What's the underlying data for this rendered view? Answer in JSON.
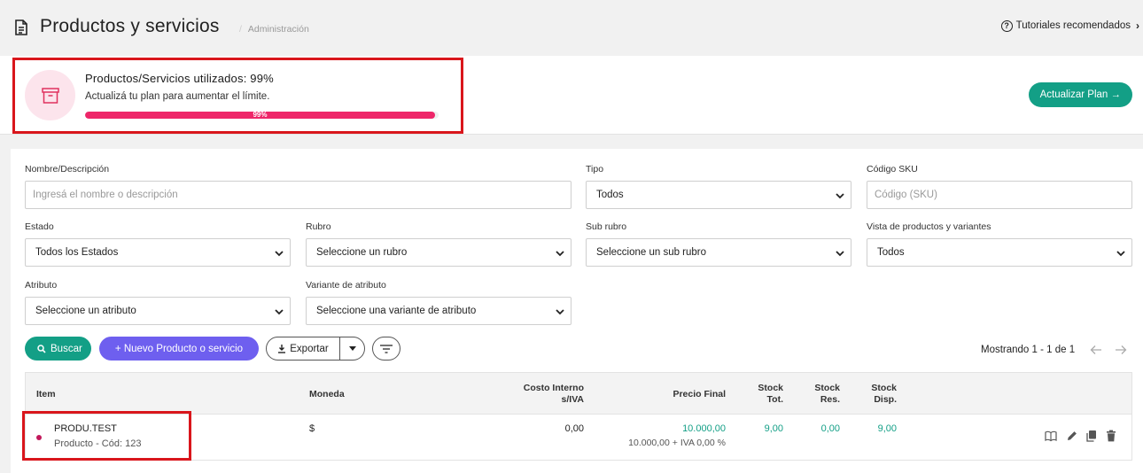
{
  "header": {
    "title": "Productos y servicios",
    "breadcrumb_sep": "/",
    "breadcrumb": "Administración",
    "tutorials_label": "Tutoriales recomendados"
  },
  "banner": {
    "usage_title": "Productos/Servicios utilizados: 99%",
    "usage_subtitle": "Actualizá tu plan para aumentar el límite.",
    "usage_percent": 99,
    "usage_bar_label": "99%",
    "upgrade_button": "Actualizar Plan →",
    "accent_color": "#ee2669"
  },
  "filters": {
    "name_label": "Nombre/Descripción",
    "name_placeholder": "Ingresá el nombre o descripción",
    "tipo_label": "Tipo",
    "tipo_value": "Todos",
    "sku_label": "Código SKU",
    "sku_placeholder": "Código (SKU)",
    "estado_label": "Estado",
    "estado_value": "Todos los Estados",
    "rubro_label": "Rubro",
    "rubro_value": "Seleccione un rubro",
    "subrubro_label": "Sub rubro",
    "subrubro_value": "Seleccione un sub rubro",
    "vista_label": "Vista de productos y variantes",
    "vista_value": "Todos",
    "atributo_label": "Atributo",
    "atributo_value": "Seleccione un atributo",
    "variante_label": "Variante de atributo",
    "variante_value": "Seleccione una variante de atributo"
  },
  "toolbar": {
    "search_button": "Buscar",
    "new_button": "+ Nuevo Producto o servicio",
    "export_button": "Exportar",
    "showing": "Mostrando 1 - 1 de 1"
  },
  "table": {
    "headers": {
      "item": "Item",
      "moneda": "Moneda",
      "costo_1": "Costo Interno",
      "costo_2": "s/IVA",
      "precio": "Precio Final",
      "stock_tot_1": "Stock",
      "stock_tot_2": "Tot.",
      "stock_res_1": "Stock",
      "stock_res_2": "Res.",
      "stock_disp_1": "Stock",
      "stock_disp_2": "Disp."
    },
    "rows": [
      {
        "name": "PRODU.TEST",
        "subtitle": "Producto - Cód: 123",
        "moneda": "$",
        "costo": "0,00",
        "precio": "10.000,00",
        "precio_detalle": "10.000,00 + IVA 0,00 %",
        "stock_tot": "9,00",
        "stock_res": "0,00",
        "stock_disp": "9,00"
      }
    ]
  }
}
